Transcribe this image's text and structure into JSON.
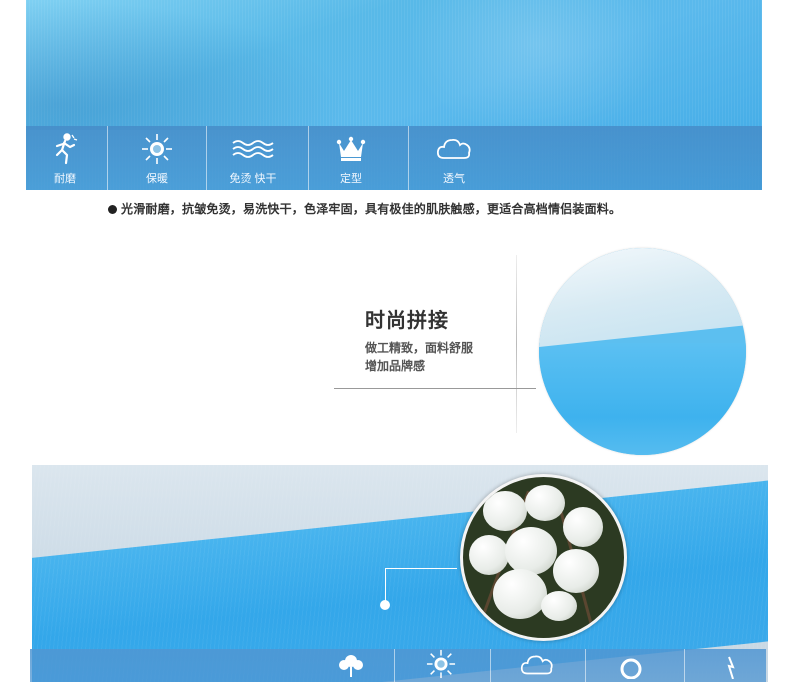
{
  "features_top": [
    {
      "label": "耐磨",
      "icon": "runner-icon"
    },
    {
      "label": "保暖",
      "icon": "sun-icon"
    },
    {
      "label": "免烫 快干",
      "icon": "waves-icon"
    },
    {
      "label": "定型",
      "icon": "crown-icon"
    },
    {
      "label": "透气",
      "icon": "cloud-icon"
    }
  ],
  "description": "光滑耐磨，抗皱免烫，易洗快干，色泽牢固，具有极佳的肌肤触感，更适合高档情侣装面料。",
  "splice_section": {
    "title": "时尚拼接",
    "line1": "做工精致，面料舒服",
    "line2": "增加品牌感"
  },
  "features_bottom": [
    {
      "icon": "flower-icon"
    },
    {
      "icon": "sun-icon"
    },
    {
      "icon": "cloud-icon"
    },
    {
      "icon": "ring-icon"
    },
    {
      "icon": "lightning-icon"
    }
  ],
  "colors": {
    "fabric_blue": "#4fb6ea",
    "feature_bar": "#4a96cc",
    "text_dark": "#333333"
  }
}
